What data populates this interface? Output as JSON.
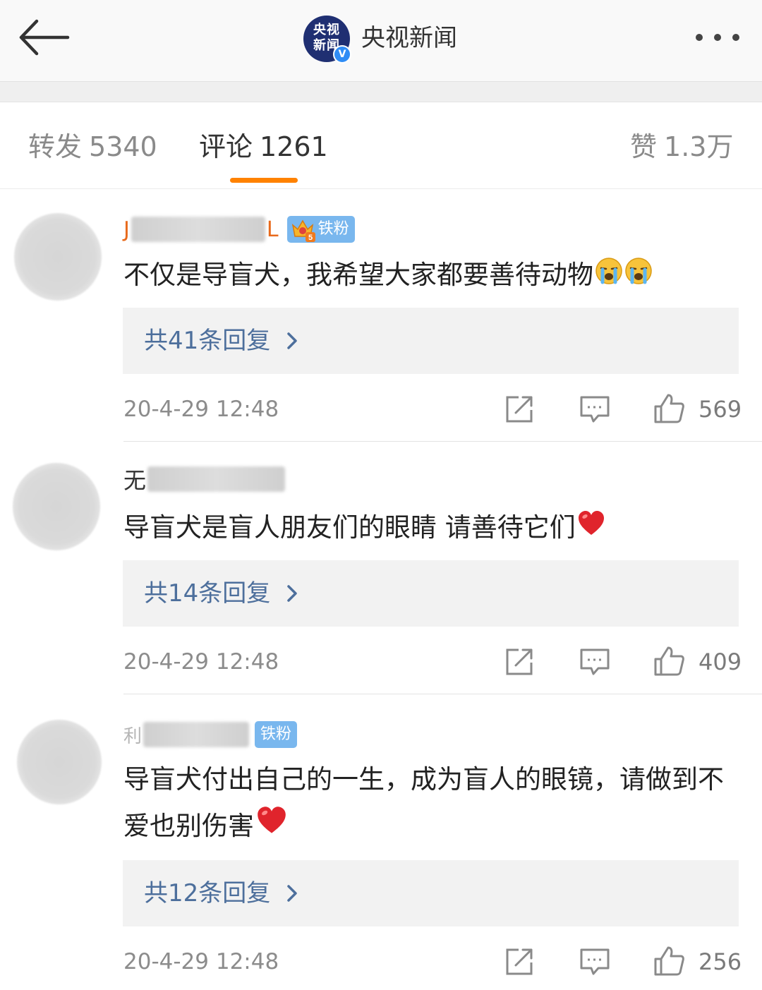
{
  "header": {
    "account_name": "央视新闻",
    "logo_line1": "央视",
    "logo_line2": "新闻",
    "verified_mark": "V",
    "back_icon": "back-arrow-icon",
    "more_icon": "more-dots-icon"
  },
  "tabs": [
    {
      "label": "转发",
      "count": "5340",
      "active": false
    },
    {
      "label": "评论",
      "count": "1261",
      "active": true
    },
    {
      "label": "赞",
      "count": "1.3万",
      "active": false
    }
  ],
  "accent_color": "#ff8200",
  "link_color": "#4d6f9c",
  "comments": [
    {
      "name_prefix": "J",
      "name_suffix": "L",
      "badge": "铁粉",
      "badge_level": "5",
      "text": "不仅是导盲犬，我希望大家都要善待动物",
      "emoji": "crying-face-icon",
      "replies": "共41条回复",
      "time": "20-4-29 12:48",
      "likes": "569"
    },
    {
      "name_prefix": "无",
      "text": "导盲犬是盲人朋友们的眼睛 请善待它们",
      "emoji": "red-heart-icon",
      "replies": "共14条回复",
      "time": "20-4-29 12:48",
      "likes": "409"
    },
    {
      "name_prefix": "利",
      "badge": "铁粉",
      "text": "导盲犬付出自己的一生，成为盲人的眼镜，请做到不爱也别伤害",
      "emoji": "red-heart-icon",
      "replies": "共12条回复",
      "time": "20-4-29 12:48",
      "likes": "256"
    }
  ]
}
